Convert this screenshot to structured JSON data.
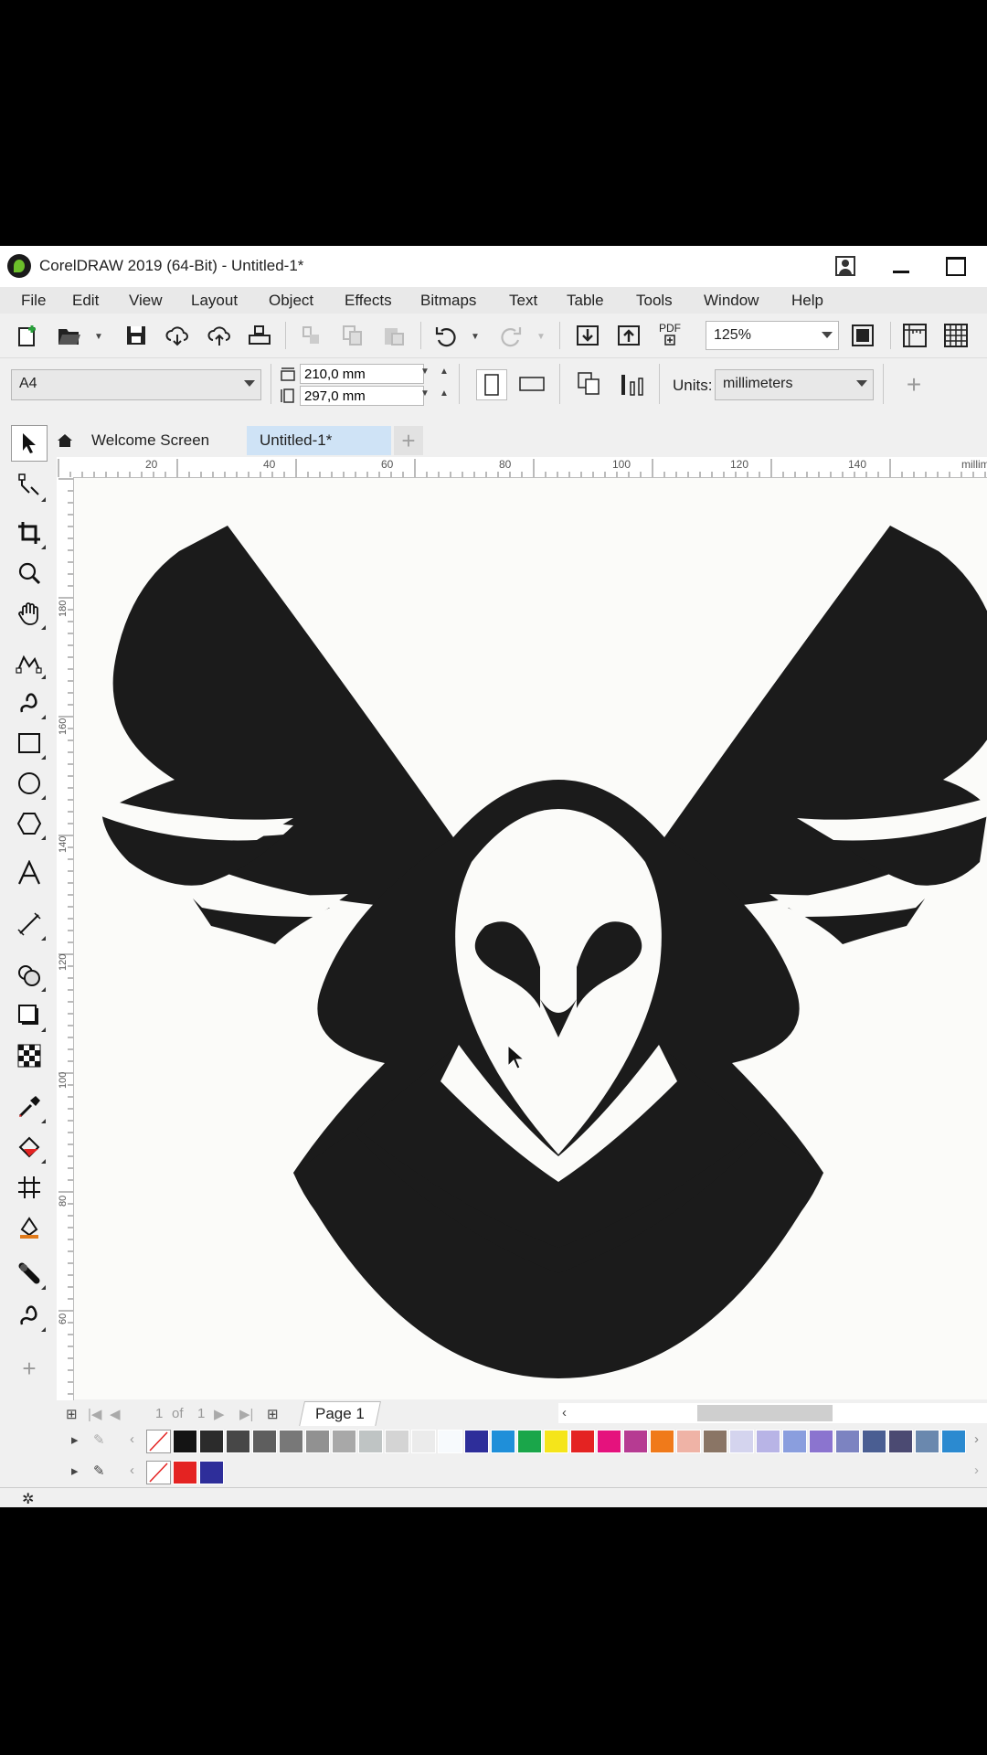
{
  "window": {
    "title": "CorelDRAW 2019 (64-Bit) - Untitled-1*"
  },
  "menu": {
    "items": [
      {
        "label": "File"
      },
      {
        "label": "Edit"
      },
      {
        "label": "View"
      },
      {
        "label": "Layout"
      },
      {
        "label": "Object"
      },
      {
        "label": "Effects"
      },
      {
        "label": "Bitmaps"
      },
      {
        "label": "Text"
      },
      {
        "label": "Table"
      },
      {
        "label": "Tools"
      },
      {
        "label": "Window"
      },
      {
        "label": "Help"
      }
    ]
  },
  "toolbar": {
    "zoom_value": "125%",
    "pdf_label": "PDF"
  },
  "property_bar": {
    "page_size": "A4",
    "width": "210,0 mm",
    "height": "297,0 mm",
    "units_label": "Units:",
    "units_value": "millimeters"
  },
  "tabs": [
    {
      "label": "Welcome Screen"
    },
    {
      "label": "Untitled-1*"
    }
  ],
  "ruler_h_ticks": [
    "20",
    "40",
    "60",
    "80",
    "100",
    "120",
    "140",
    "millim"
  ],
  "ruler_v_ticks": [
    "180",
    "160",
    "140",
    "120",
    "100",
    "80",
    "60"
  ],
  "page_nav": {
    "current": "1",
    "of_label": "of",
    "total": "1",
    "page_tab": "Page 1"
  },
  "palette_main": [
    "#141414",
    "#2b2b2b",
    "#474747",
    "#5e5e5e",
    "#787878",
    "#919191",
    "#a8a8a8",
    "#bfc4c4",
    "#d4d4d4",
    "#ebebeb",
    "#f7fafd",
    "#2e2e9a",
    "#1f8fd9",
    "#1aa64a",
    "#f5e51a",
    "#e42322",
    "#e5127d",
    "#b63b92",
    "#f07a1a",
    "#efb3a6",
    "#8a7565",
    "#d4d4ee",
    "#b8b4e6",
    "#8a9ede",
    "#8b74cf",
    "#7c83c1",
    "#4a5e92",
    "#4b4a72",
    "#6a88ae",
    "#2b8ad0"
  ],
  "palette_doc": [
    "#e42322",
    "#2e2e9a"
  ],
  "colors": {
    "accent_tab": "#cfe3f6",
    "artwork": "#1b1b1b",
    "canvas": "#fbfbf9"
  }
}
